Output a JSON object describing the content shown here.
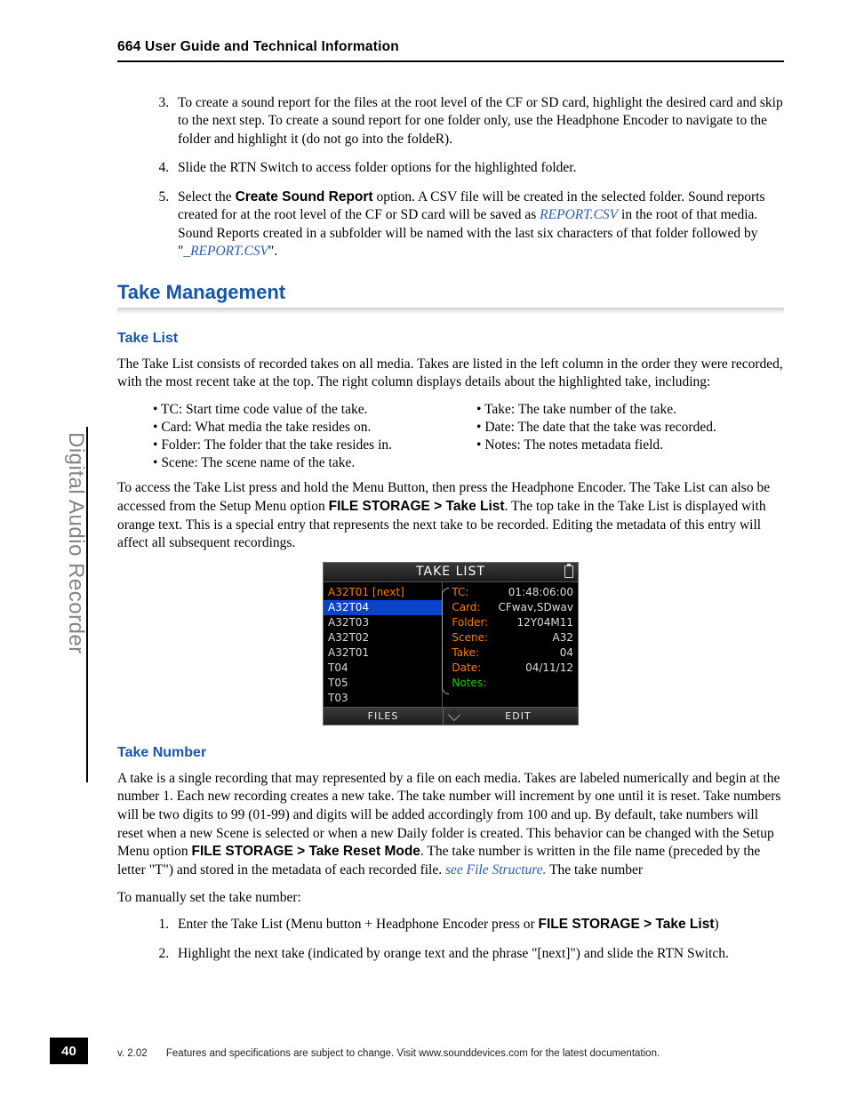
{
  "header": "664 User Guide and Technical Information",
  "steps_a": [
    {
      "n": "3.",
      "text": "To create a sound report for the files at the root level of the CF or SD card, highlight the desired card and skip to the next step. To create a sound report for one folder only, use the Headphone Encoder to navigate to the folder and highlight it (do not go into the foldeR)."
    },
    {
      "n": "4.",
      "text": "Slide the RTN Switch to access folder options for the highlighted folder."
    },
    {
      "n": "5.",
      "pre": "Select the ",
      "bold1": "Create Sound Report",
      "mid1": " option. A CSV file will be created in the selected folder. Sound reports created for at the root level of the CF or SD card will be saved as ",
      "link1": "REPORT.CSV",
      "mid2": " in the root of that media. Sound Reports created in a subfolder will be named with the last six characters of that folder followed by \"",
      "link2": "_REPORT.CSV",
      "post": "\"."
    }
  ],
  "section_title": "Take Management",
  "take_list": {
    "heading": "Take List",
    "p1": "The Take List consists of recorded takes on all media. Takes are listed in the left column in the order they were recorded, with the most recent take at the top. The right column displays details about the highlighted take, including:",
    "bullets_left": [
      "TC: Start time code value of the take.",
      "Card: What media the take resides on.",
      "Folder: The folder that the take resides in.",
      "Scene: The scene name of the take."
    ],
    "bullets_right": [
      "Take: The take number of the take.",
      "Date: The date that the take was recorded.",
      "Notes: The notes metadata field."
    ],
    "p2_pre": "To access the Take List press and hold the Menu Button, then press the Headphone Encoder. The Take List can also be accessed from the Setup Menu option ",
    "p2_bold": "FILE STORAGE > Take List",
    "p2_post": ". The top take in the Take List is displayed with orange text. This is a special entry that represents the next take to be recorded. Editing the metadata of this entry will affect all subsequent recordings."
  },
  "device": {
    "title": "TAKE LIST",
    "items": [
      {
        "label": "A32T01 [next]",
        "cls": "next"
      },
      {
        "label": "A32T04",
        "cls": "sel"
      },
      {
        "label": "A32T03",
        "cls": ""
      },
      {
        "label": "A32T02",
        "cls": ""
      },
      {
        "label": "A32T01",
        "cls": ""
      },
      {
        "label": "T04",
        "cls": ""
      },
      {
        "label": "T05",
        "cls": ""
      },
      {
        "label": "T03",
        "cls": ""
      }
    ],
    "kv": [
      {
        "k": "TC:",
        "v": "01:48:06:00",
        "kg": false
      },
      {
        "k": "Card:",
        "v": "CFwav,SDwav",
        "kg": false
      },
      {
        "k": "Folder:",
        "v": "12Y04M11",
        "kg": false
      },
      {
        "k": "Scene:",
        "v": "A32",
        "kg": false
      },
      {
        "k": "Take:",
        "v": "04",
        "kg": false
      },
      {
        "k": "Date:",
        "v": "04/11/12",
        "kg": false
      },
      {
        "k": "Notes:",
        "v": "",
        "kg": true
      }
    ],
    "foot_left": "FILES",
    "foot_right": "EDIT"
  },
  "take_number": {
    "heading": "Take Number",
    "p1_pre": "A take is a single recording that may represented by a file on each media. Takes are labeled numerically and begin at the number 1. Each new recording creates a new take. The take number will increment by one until it is reset. Take numbers will be two digits to 99 (01-99) and digits will be added accordingly from 100 and up. By default, take numbers will reset when a new Scene is selected or when a new Daily folder is created. This behavior can be changed with the Setup Menu option ",
    "p1_bold": "FILE STORAGE > Take Reset Mode",
    "p1_mid": ". The take number is written in the file name (preceded by the letter \"T\") and stored in the metadata of each recorded file. ",
    "p1_link": "see File Structure.",
    "p1_post": " The take number",
    "p2": "To manually set the take number:",
    "steps": [
      {
        "pre": "Enter the Take List (Menu button + Headphone Encoder press or ",
        "bold": "FILE STORAGE >  Take List",
        "post": ")"
      },
      {
        "pre": "Highlight the next take (indicated by orange text and the phrase \"[next]\") and slide the RTN Switch.",
        "bold": "",
        "post": ""
      }
    ]
  },
  "sidebar": "Digital Audio Recorder",
  "page_number": "40",
  "footer_version": "v. 2.02",
  "footer_text": "Features and specifications are subject to change. Visit www.sounddevices.com for the latest documentation."
}
